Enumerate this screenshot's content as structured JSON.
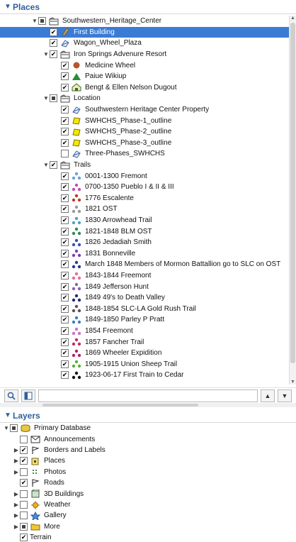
{
  "places": {
    "title": "Places",
    "rows": [
      {
        "label": "Southwestern_Heritage_Center",
        "indent": 44,
        "exp": "▼",
        "check": "partial",
        "icon": "folder"
      },
      {
        "label": "First Building",
        "indent": 60,
        "exp": "",
        "check": "checked",
        "icon": "building",
        "selected": true
      },
      {
        "label": "Wagon_Wheel_Plaza",
        "indent": 60,
        "exp": "",
        "check": "checked",
        "icon": "polygon"
      },
      {
        "label": "Iron Springs Advenure Resort",
        "indent": 60,
        "exp": "▼",
        "check": "checked",
        "icon": "folder"
      },
      {
        "label": "Medicine Wheel",
        "indent": 76,
        "exp": "",
        "check": "checked",
        "icon": "brown-dot"
      },
      {
        "label": "Paiue Wikiup",
        "indent": 76,
        "exp": "",
        "check": "checked",
        "icon": "green-triangle"
      },
      {
        "label": "Bengt & Ellen Nelson Dugout",
        "indent": 76,
        "exp": "",
        "check": "checked",
        "icon": "house"
      },
      {
        "label": "Location",
        "indent": 60,
        "exp": "▼",
        "check": "partial",
        "icon": "folder"
      },
      {
        "label": "Southwestern Heritage Center Property",
        "indent": 76,
        "exp": "",
        "check": "checked",
        "icon": "polygon"
      },
      {
        "label": "SWHCHS_Phase-1_outline",
        "indent": 76,
        "exp": "",
        "check": "checked",
        "icon": "yellow-shape"
      },
      {
        "label": "SWHCHS_Phase-2_outline",
        "indent": 76,
        "exp": "",
        "check": "checked",
        "icon": "yellow-shape"
      },
      {
        "label": "SWHCHS_Phase-3_outline",
        "indent": 76,
        "exp": "",
        "check": "checked",
        "icon": "yellow-shape"
      },
      {
        "label": "Three-Phases_SWHCHS",
        "indent": 76,
        "exp": "",
        "check": "empty",
        "icon": "polygon"
      },
      {
        "label": "Trails",
        "indent": 60,
        "exp": "▼",
        "check": "checked",
        "icon": "folder"
      },
      {
        "label": "0001-1300 Fremont",
        "indent": 76,
        "exp": "",
        "check": "checked",
        "icon": "trail",
        "color": "#6a9fd8"
      },
      {
        "label": "0700-1350 Pueblo I & II & III",
        "indent": 76,
        "exp": "",
        "check": "checked",
        "icon": "trail",
        "color": "#c04fb0"
      },
      {
        "label": "1776 Escalente",
        "indent": 76,
        "exp": "",
        "check": "checked",
        "icon": "trail",
        "color": "#c0392b"
      },
      {
        "label": "1821 OST",
        "indent": 76,
        "exp": "",
        "check": "checked",
        "icon": "trail",
        "color": "#9a9a9a"
      },
      {
        "label": "1830 Arrowhead Trail",
        "indent": 76,
        "exp": "",
        "check": "checked",
        "icon": "trail",
        "color": "#4aa3c8"
      },
      {
        "label": "1821-1848 BLM OST",
        "indent": 76,
        "exp": "",
        "check": "checked",
        "icon": "trail",
        "color": "#2e8b57"
      },
      {
        "label": "1826 Jedadiah Smith",
        "indent": 76,
        "exp": "",
        "check": "checked",
        "icon": "trail",
        "color": "#3d4fb0"
      },
      {
        "label": "1831 Bonneville",
        "indent": 76,
        "exp": "",
        "check": "checked",
        "icon": "trail",
        "color": "#7b3fb0"
      },
      {
        "label": "March 1848 Members of Mormon Battallion go to SLC on OST",
        "indent": 76,
        "exp": "",
        "check": "checked",
        "icon": "trail",
        "color": "#1e3f8f"
      },
      {
        "label": "1843-1844 Freemont",
        "indent": 76,
        "exp": "",
        "check": "checked",
        "icon": "trail",
        "color": "#e07090"
      },
      {
        "label": "1849 Jefferson Hunt",
        "indent": 76,
        "exp": "",
        "check": "checked",
        "icon": "trail",
        "color": "#8a5fb0"
      },
      {
        "label": "1849 49's to Death Valley",
        "indent": 76,
        "exp": "",
        "check": "checked",
        "icon": "trail",
        "color": "#202a6f"
      },
      {
        "label": "1848-1854 SLC-LA Gold Rush Trail",
        "indent": 76,
        "exp": "",
        "check": "checked",
        "icon": "trail",
        "color": "#555555"
      },
      {
        "label": "1849-1850 Parley P Pratt",
        "indent": 76,
        "exp": "",
        "check": "checked",
        "icon": "trail",
        "color": "#3f7fbf"
      },
      {
        "label": "1854 Freemont",
        "indent": 76,
        "exp": "",
        "check": "checked",
        "icon": "trail",
        "color": "#d070c0"
      },
      {
        "label": "1857 Fancher Trail",
        "indent": 76,
        "exp": "",
        "check": "checked",
        "icon": "trail",
        "color": "#c02f5f"
      },
      {
        "label": "1869 Wheeler Expidition",
        "indent": 76,
        "exp": "",
        "check": "checked",
        "icon": "trail",
        "color": "#b01f6f"
      },
      {
        "label": "1905-1915 Union Sheep Trail",
        "indent": 76,
        "exp": "",
        "check": "checked",
        "icon": "trail",
        "color": "#5cae3a"
      },
      {
        "label": "1923-06-17 First Train to Cedar",
        "indent": 76,
        "exp": "",
        "check": "checked",
        "icon": "trail",
        "color": "#111111"
      }
    ]
  },
  "toolbar": {
    "search_value": "",
    "up_label": "▲",
    "down_label": "▼"
  },
  "layers": {
    "title": "Layers",
    "rows": [
      {
        "label": "Primary Database",
        "indent": 4,
        "exp": "▼",
        "check": "partial",
        "icon": "database"
      },
      {
        "label": "Announcements",
        "indent": 18,
        "exp": "",
        "check": "empty",
        "icon": "envelope"
      },
      {
        "label": "Borders and Labels",
        "indent": 18,
        "exp": "▶",
        "check": "checked",
        "icon": "flag"
      },
      {
        "label": "Places",
        "indent": 18,
        "exp": "▶",
        "check": "checked",
        "icon": "places-square"
      },
      {
        "label": "Photos",
        "indent": 18,
        "exp": "▶",
        "check": "empty",
        "icon": "photo"
      },
      {
        "label": "Roads",
        "indent": 18,
        "exp": "",
        "check": "checked",
        "icon": "flag"
      },
      {
        "label": "3D Buildings",
        "indent": 18,
        "exp": "▶",
        "check": "empty",
        "icon": "building3d"
      },
      {
        "label": "Weather",
        "indent": 18,
        "exp": "▶",
        "check": "empty",
        "icon": "sun"
      },
      {
        "label": "Gallery",
        "indent": 18,
        "exp": "▶",
        "check": "empty",
        "icon": "star"
      },
      {
        "label": "More",
        "indent": 18,
        "exp": "▶",
        "check": "partial",
        "icon": "folder-yellow"
      },
      {
        "label": "Terrain",
        "indent": 18,
        "exp": "",
        "check": "checked",
        "icon": "none"
      }
    ]
  },
  "colors": {
    "header_text": "#2f5f9e",
    "selection": "#3a7bd5"
  }
}
